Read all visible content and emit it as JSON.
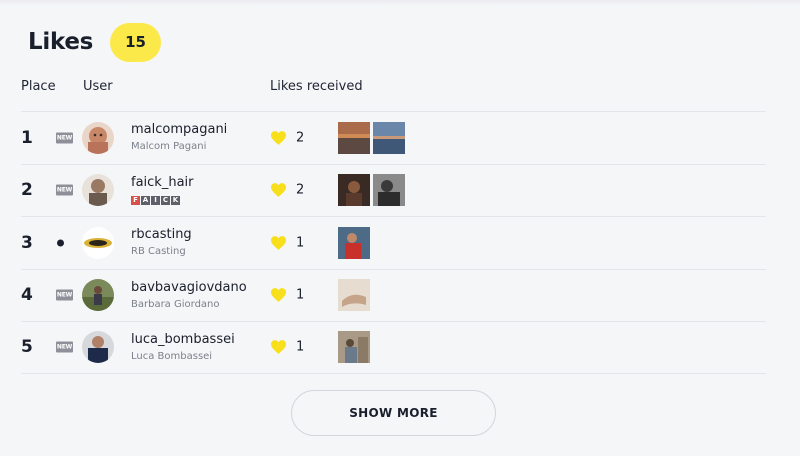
{
  "header": {
    "title": "Likes",
    "count": "15"
  },
  "columns": {
    "place": "Place",
    "user": "User",
    "likes": "Likes received"
  },
  "new_badge_label": "NEW",
  "rows": [
    {
      "place": "1",
      "status": "new",
      "username": "malcompagani",
      "full_name": "Malcom Pagani",
      "likes": "2",
      "thumb_count": 2
    },
    {
      "place": "2",
      "status": "new",
      "username": "faick_hair",
      "full_name": "",
      "logo_text": [
        "F",
        "A",
        "I",
        "C",
        "K"
      ],
      "likes": "2",
      "thumb_count": 2
    },
    {
      "place": "3",
      "status": "dot",
      "username": "rbcasting",
      "full_name": "RB Casting",
      "likes": "1",
      "thumb_count": 1
    },
    {
      "place": "4",
      "status": "new",
      "username": "bavbavagiovdano",
      "full_name": "Barbara Giordano",
      "likes": "1",
      "thumb_count": 1
    },
    {
      "place": "5",
      "status": "new",
      "username": "luca_bombassei",
      "full_name": "Luca Bombassei",
      "likes": "1",
      "thumb_count": 1
    }
  ],
  "show_more_label": "SHOW MORE",
  "colors": {
    "accent_yellow": "#fbe94a",
    "heart_yellow": "#f8df1c",
    "text_dark": "#1a1f2c",
    "divider": "#e3e5ea"
  },
  "icons": {
    "like": "heart-icon",
    "new": "new-badge"
  }
}
